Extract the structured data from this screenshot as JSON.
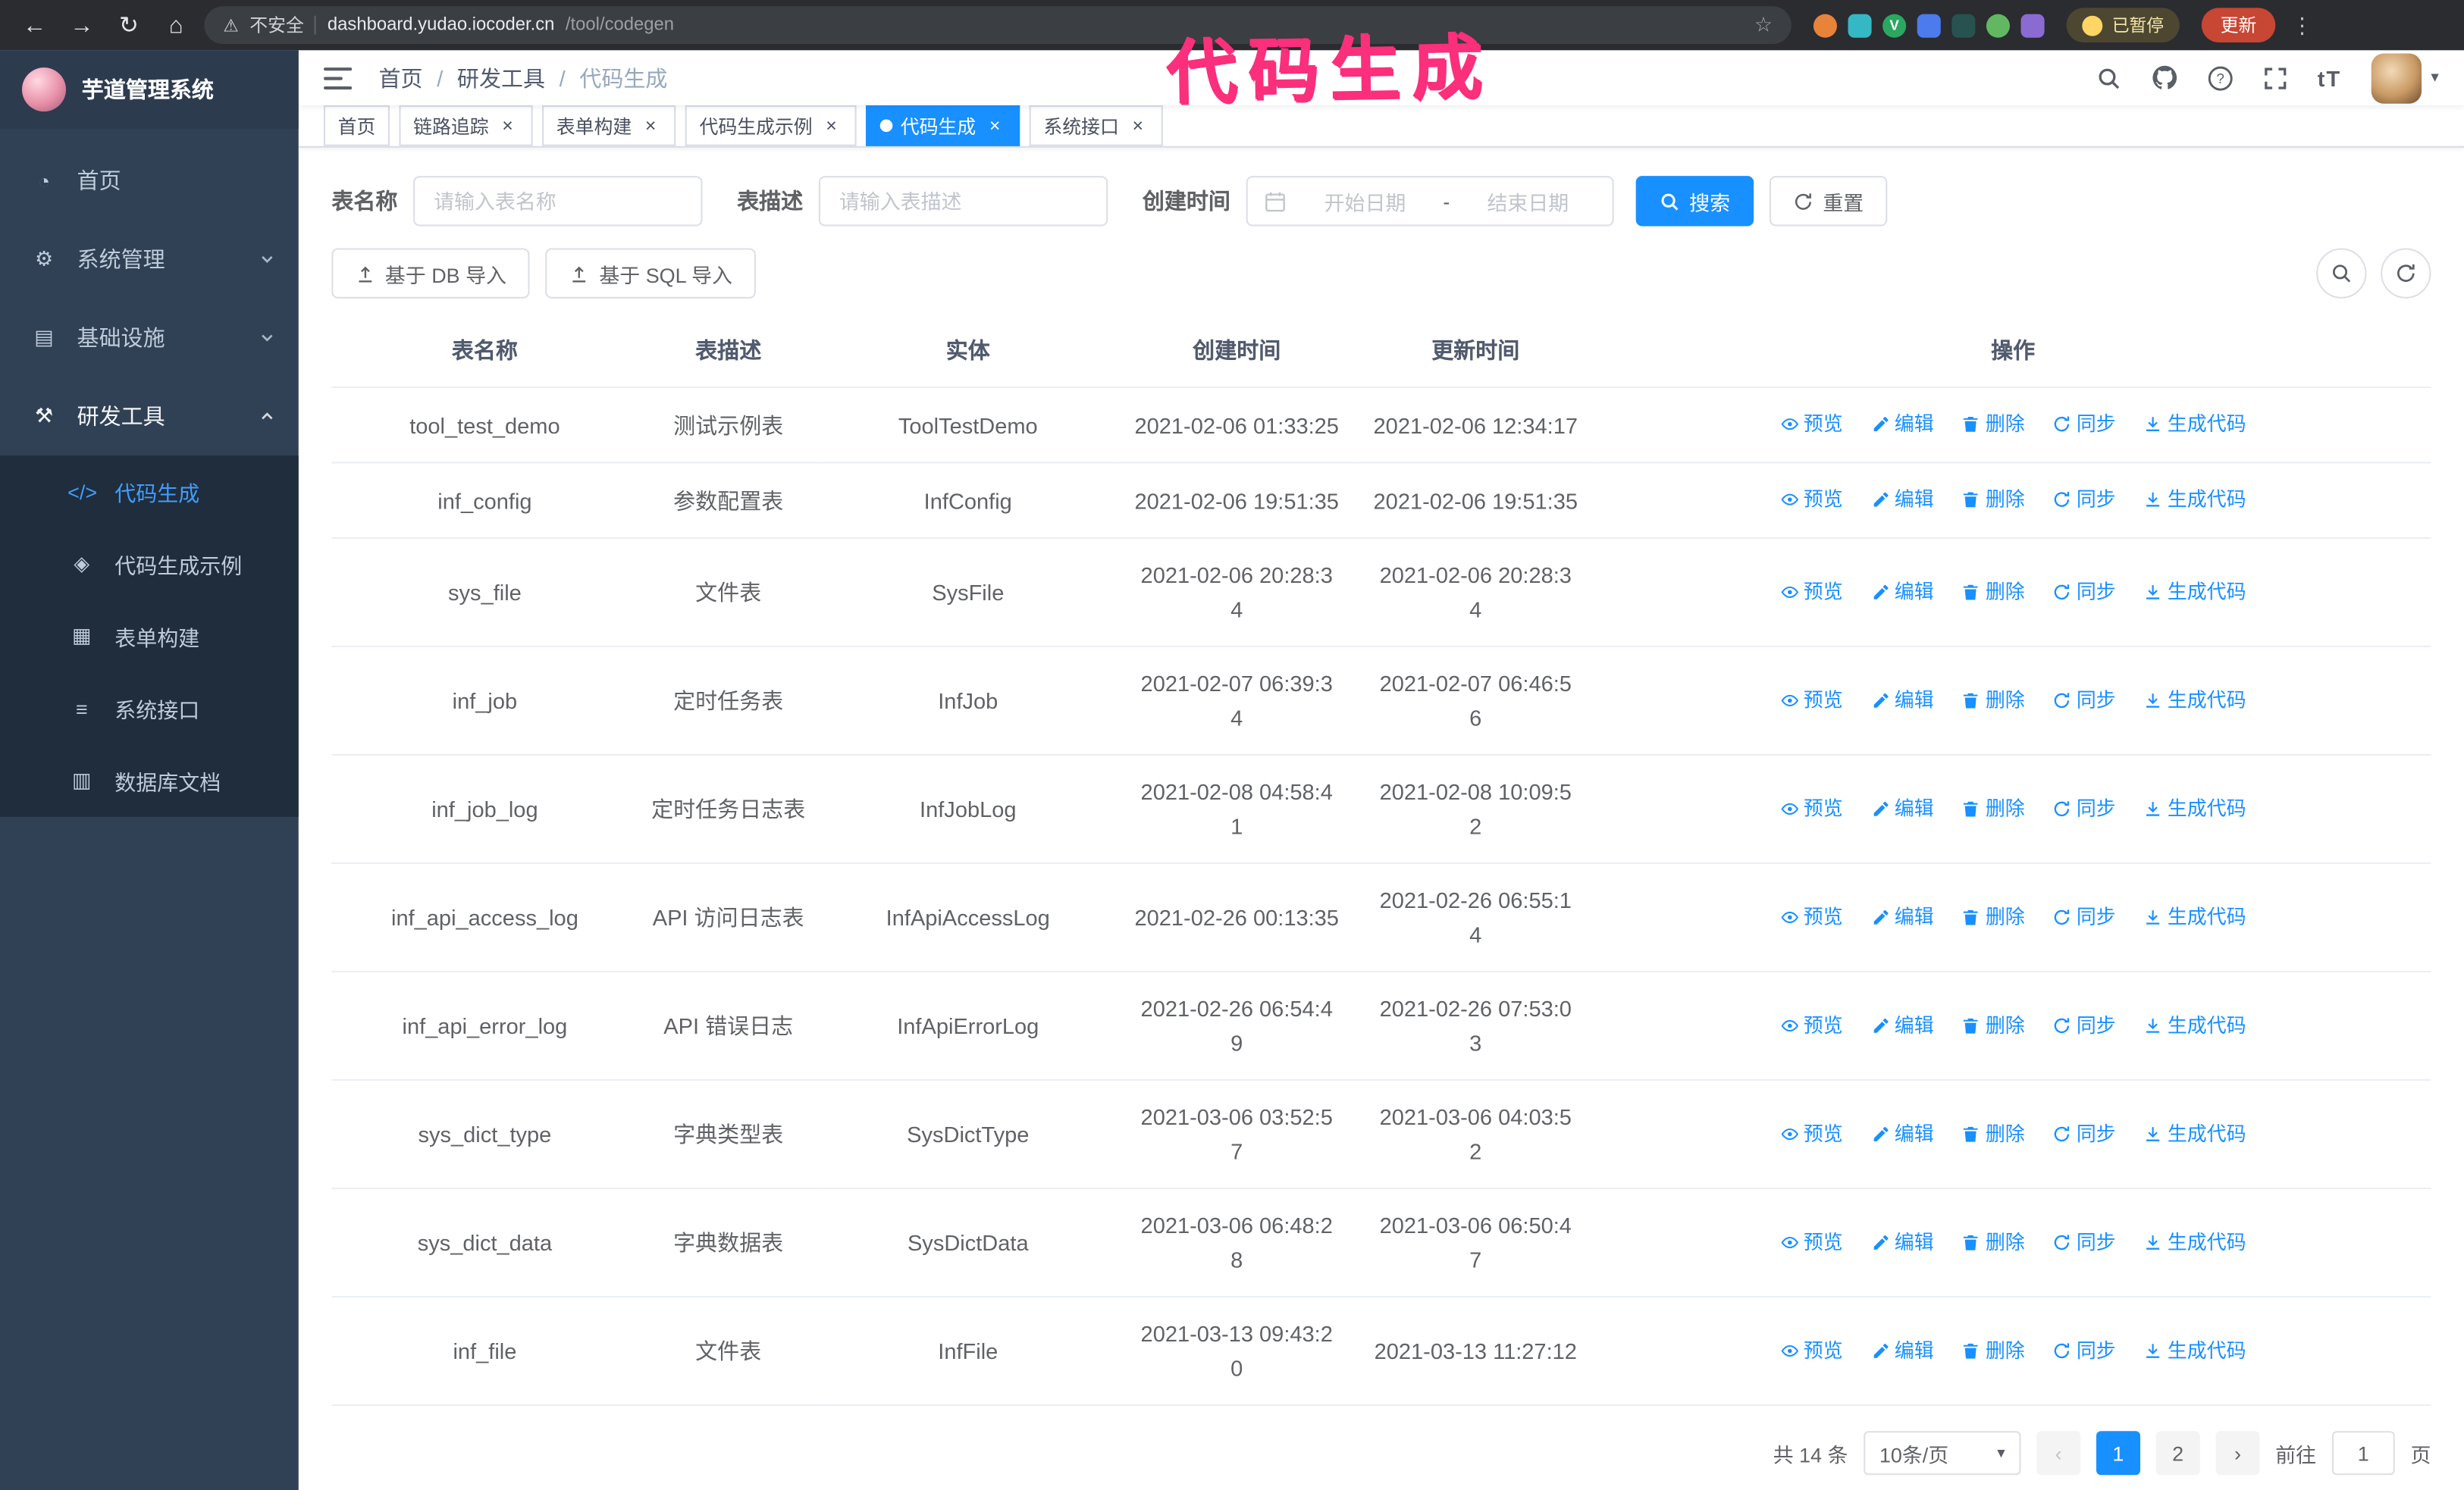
{
  "colors": {
    "primary": "#1890ff",
    "sidebar_bg": "#304156",
    "submenu_bg": "#1f2d3d",
    "annotation_pink": "#fb2f7b",
    "update_button_red": "#c74634",
    "active_tab_bg": "#1890ff"
  },
  "icons": {
    "back": "←",
    "forward": "→",
    "reload": "↻",
    "home": "⌂",
    "warning": "⚠",
    "star": "☆",
    "kebab": "⋮",
    "dashboard": "◔",
    "system": "⚙",
    "infra": "▤",
    "tools": "⚒",
    "code": "</>",
    "example": "◈",
    "form": "▦",
    "api": "≡",
    "db": "▥",
    "close": "×",
    "caret": "▾",
    "fontsize": "tT",
    "prev": "‹",
    "next": "›"
  },
  "browser": {
    "security_label": "不安全",
    "url_host": "dashboard.yudao.iocoder.cn",
    "url_path": "/tool/codegen",
    "paused_badge": "已暂停",
    "update_button": "更新"
  },
  "annotation": {
    "text": "代码生成"
  },
  "sidebar": {
    "logo_title": "芋道管理系统",
    "items": [
      {
        "label": "首页"
      },
      {
        "label": "系统管理"
      },
      {
        "label": "基础设施"
      },
      {
        "label": "研发工具"
      }
    ],
    "submenu": [
      {
        "label": "代码生成",
        "active": true
      },
      {
        "label": "代码生成示例"
      },
      {
        "label": "表单构建"
      },
      {
        "label": "系统接口"
      },
      {
        "label": "数据库文档"
      }
    ]
  },
  "breadcrumb": {
    "items": [
      "首页",
      "研发工具",
      "代码生成"
    ],
    "separator": "/"
  },
  "tabs": {
    "items": [
      "首页",
      "链路追踪",
      "表单构建",
      "代码生成示例",
      "代码生成",
      "系统接口"
    ],
    "active_tab": "代码生成"
  },
  "filters": {
    "table_name_label": "表名称",
    "table_name_placeholder": "请输入表名称",
    "table_desc_label": "表描述",
    "table_desc_placeholder": "请输入表描述",
    "create_time_label": "创建时间",
    "date_start_placeholder": "开始日期",
    "date_separator": "-",
    "date_end_placeholder": "结束日期",
    "search_button": "搜索",
    "reset_button": "重置"
  },
  "toolbar": {
    "import_db_button": "基于 DB 导入",
    "import_sql_button": "基于 SQL 导入"
  },
  "table": {
    "columns": [
      "表名称",
      "表描述",
      "实体",
      "创建时间",
      "更新时间",
      "操作"
    ],
    "actions": [
      "预览",
      "编辑",
      "删除",
      "同步",
      "生成代码"
    ],
    "rows": [
      {
        "name": "tool_test_demo",
        "desc": "测试示例表",
        "entity": "ToolTestDemo",
        "created": "2021-02-06 01:33:25",
        "updated": "2021-02-06 12:34:17"
      },
      {
        "name": "inf_config",
        "desc": "参数配置表",
        "entity": "InfConfig",
        "created": "2021-02-06 19:51:35",
        "updated": "2021-02-06 19:51:35"
      },
      {
        "name": "sys_file",
        "desc": "文件表",
        "entity": "SysFile",
        "created": "2021-02-06 20:28:3\n4",
        "updated": "2021-02-06 20:28:3\n4"
      },
      {
        "name": "inf_job",
        "desc": "定时任务表",
        "entity": "InfJob",
        "created": "2021-02-07 06:39:3\n4",
        "updated": "2021-02-07 06:46:5\n6"
      },
      {
        "name": "inf_job_log",
        "desc": "定时任务日志表",
        "entity": "InfJobLog",
        "created": "2021-02-08 04:58:4\n1",
        "updated": "2021-02-08 10:09:5\n2"
      },
      {
        "name": "inf_api_access_log",
        "desc": "API 访问日志表",
        "entity": "InfApiAccessLog",
        "created": "2021-02-26 00:13:35",
        "updated": "2021-02-26 06:55:1\n4"
      },
      {
        "name": "inf_api_error_log",
        "desc": "API 错误日志",
        "entity": "InfApiErrorLog",
        "created": "2021-02-26 06:54:4\n9",
        "updated": "2021-02-26 07:53:0\n3"
      },
      {
        "name": "sys_dict_type",
        "desc": "字典类型表",
        "entity": "SysDictType",
        "created": "2021-03-06 03:52:5\n7",
        "updated": "2021-03-06 04:03:5\n2"
      },
      {
        "name": "sys_dict_data",
        "desc": "字典数据表",
        "entity": "SysDictData",
        "created": "2021-03-06 06:48:2\n8",
        "updated": "2021-03-06 06:50:4\n7"
      },
      {
        "name": "inf_file",
        "desc": "文件表",
        "entity": "InfFile",
        "created": "2021-03-13 09:43:2\n0",
        "updated": "2021-03-13 11:27:12"
      }
    ]
  },
  "pagination": {
    "total_text": "共 14 条",
    "page_size": "10条/页",
    "pages": [
      "1",
      "2"
    ],
    "active_page": "1",
    "goto_label": "前往",
    "goto_value": "1",
    "goto_unit": "页"
  }
}
